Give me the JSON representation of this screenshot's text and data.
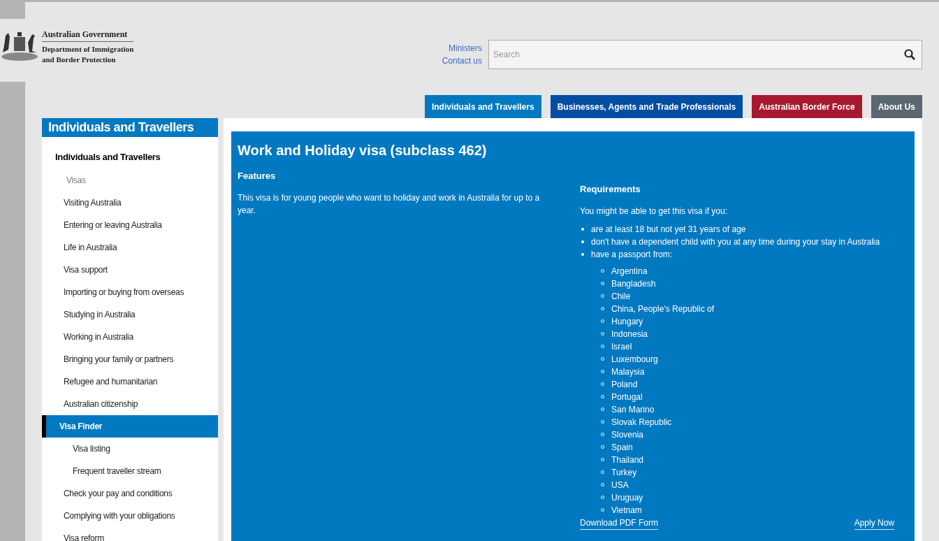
{
  "header": {
    "logo_lines": [
      "Australian Government",
      "Department of Immigration",
      "and Border Protection"
    ],
    "links": [
      "Ministers",
      "Contact us"
    ],
    "search": {
      "placeholder": "Search"
    }
  },
  "nav_tabs": [
    {
      "label": "Individuals and Travellers",
      "color": "#0079c1"
    },
    {
      "label": "Businesses, Agents and Trade Professionals",
      "color": "#034ea2"
    },
    {
      "label": "Australian Border Force",
      "color": "#a6192e"
    },
    {
      "label": "About Us",
      "color": "#5b6770"
    }
  ],
  "sidebar": {
    "title": "Individuals and Travellers",
    "items": [
      {
        "kind": "heading",
        "label": "Individuals and Travellers",
        "selected": false
      },
      {
        "kind": "section",
        "label": "Visas",
        "selected": false
      },
      {
        "kind": "link",
        "label": "Visiting Australia",
        "selected": false
      },
      {
        "kind": "link",
        "label": "Entering or leaving Australia",
        "selected": false
      },
      {
        "kind": "link",
        "label": "Life in Australia",
        "selected": false
      },
      {
        "kind": "link",
        "label": "Visa support",
        "selected": false
      },
      {
        "kind": "link",
        "label": "Importing or buying from overseas",
        "selected": false
      },
      {
        "kind": "link",
        "label": "Studying in Australia",
        "selected": false
      },
      {
        "kind": "link",
        "label": "Working in Australia",
        "selected": false
      },
      {
        "kind": "link",
        "label": "Bringing your family or partners",
        "selected": false
      },
      {
        "kind": "link",
        "label": "Refugee and humanitarian",
        "selected": false
      },
      {
        "kind": "link",
        "label": "Australian citizenship",
        "selected": false
      },
      {
        "kind": "link",
        "label": "Visa Finder",
        "selected": true,
        "children": [
          {
            "label": "Visa listing",
            "selected": false
          },
          {
            "label": "Frequent traveller stream",
            "selected": false
          }
        ]
      },
      {
        "kind": "link",
        "label": "Check your pay and conditions",
        "selected": false
      },
      {
        "kind": "link",
        "label": "Complying with your obligations",
        "selected": false
      },
      {
        "kind": "link",
        "label": "Visa reform",
        "selected": false
      }
    ]
  },
  "content": {
    "title": "Work and Holiday visa (subclass 462)",
    "features": {
      "heading": "Features",
      "text": "This visa is for young people who want to holiday and work in Australia for up to a year."
    },
    "requirements": {
      "heading": "Requirements",
      "intro": "You might be able to get this visa if you:",
      "bullets": [
        {
          "text": "are at least 18 but not yet 31 years of age"
        },
        {
          "text": "don't have a dependent child with you at any time during your stay in Australia"
        },
        {
          "text": "have a passport from:",
          "children": [
            "Argentina",
            "Bangladesh",
            "Chile",
            "China, People's Republic of",
            "Hungary",
            "Indonesia",
            "Israel",
            "Luxembourg",
            "Malaysia",
            "Poland",
            "Portugal",
            "San Marino",
            "Slovak Republic",
            "Slovenia",
            "Spain",
            "Thailand",
            "Turkey",
            "USA",
            "Uruguay",
            "Vietnam"
          ]
        }
      ],
      "download_link": "Download PDF Form",
      "apply_link": "Apply Now"
    }
  }
}
